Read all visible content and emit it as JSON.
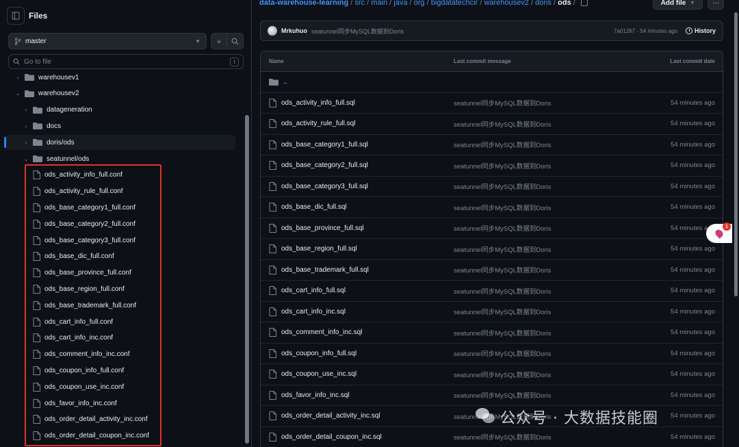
{
  "sidebar": {
    "title": "Files",
    "branch": "master",
    "search_placeholder": "Go to file",
    "search_shortcut": "t",
    "tree": [
      {
        "label": "warehousev1",
        "kind": "folder",
        "depth": 0,
        "expanded": false
      },
      {
        "label": "warehousev2",
        "kind": "folder",
        "depth": 0,
        "expanded": true
      },
      {
        "label": "datageneration",
        "kind": "folder",
        "depth": 1,
        "expanded": false
      },
      {
        "label": "docs",
        "kind": "folder",
        "depth": 1,
        "expanded": false
      },
      {
        "label": "doris/ods",
        "kind": "folder",
        "depth": 1,
        "expanded": false,
        "active": true
      },
      {
        "label": "seatunnel/ods",
        "kind": "folder",
        "depth": 1,
        "expanded": true
      },
      {
        "label": "ods_activity_info_full.conf",
        "kind": "file",
        "depth": 2
      },
      {
        "label": "ods_activity_rule_full.conf",
        "kind": "file",
        "depth": 2
      },
      {
        "label": "ods_base_category1_full.conf",
        "kind": "file",
        "depth": 2
      },
      {
        "label": "ods_base_category2_full.conf",
        "kind": "file",
        "depth": 2
      },
      {
        "label": "ods_base_category3_full.conf",
        "kind": "file",
        "depth": 2
      },
      {
        "label": "ods_base_dic_full.conf",
        "kind": "file",
        "depth": 2
      },
      {
        "label": "ods_base_province_full.conf",
        "kind": "file",
        "depth": 2
      },
      {
        "label": "ods_base_region_full.conf",
        "kind": "file",
        "depth": 2
      },
      {
        "label": "ods_base_trademark_full.conf",
        "kind": "file",
        "depth": 2
      },
      {
        "label": "ods_cart_info_full.conf",
        "kind": "file",
        "depth": 2
      },
      {
        "label": "ods_cart_info_inc.conf",
        "kind": "file",
        "depth": 2
      },
      {
        "label": "ods_comment_info_inc.conf",
        "kind": "file",
        "depth": 2
      },
      {
        "label": "ods_coupon_info_full.conf",
        "kind": "file",
        "depth": 2
      },
      {
        "label": "ods_coupon_use_inc.conf",
        "kind": "file",
        "depth": 2
      },
      {
        "label": "ods_favor_info_inc.conf",
        "kind": "file",
        "depth": 2
      },
      {
        "label": "ods_order_detail_activity_inc.conf",
        "kind": "file",
        "depth": 2
      },
      {
        "label": "ods_order_detail_coupon_inc.conf",
        "kind": "file",
        "depth": 2
      }
    ]
  },
  "breadcrumb": {
    "repo": "data-warehouse-learning",
    "parts": [
      "src",
      "main",
      "java",
      "org",
      "bigdatatechcir",
      "warehousev2",
      "doris"
    ],
    "current": "ods",
    "sep": "/"
  },
  "toolbar": {
    "add_file": "Add file",
    "more": "···"
  },
  "commit": {
    "author": "Mrkuhuo",
    "message": "seatunnel同步MySQL数据到Doris",
    "hash_time": "7a01267 · 54 minutes ago",
    "history": "History"
  },
  "table": {
    "headers": {
      "name": "Name",
      "message": "Last commit message",
      "date": "Last commit date"
    },
    "parent": "..",
    "rows": [
      {
        "name": "ods_activity_info_full.sql",
        "message": "seatunnel同步MySQL数据到Doris",
        "date": "54 minutes ago"
      },
      {
        "name": "ods_activity_rule_full.sql",
        "message": "seatunnel同步MySQL数据到Doris",
        "date": "54 minutes ago"
      },
      {
        "name": "ods_base_category1_full.sql",
        "message": "seatunnel同步MySQL数据到Doris",
        "date": "54 minutes ago"
      },
      {
        "name": "ods_base_category2_full.sql",
        "message": "seatunnel同步MySQL数据到Doris",
        "date": "54 minutes ago"
      },
      {
        "name": "ods_base_category3_full.sql",
        "message": "seatunnel同步MySQL数据到Doris",
        "date": "54 minutes ago"
      },
      {
        "name": "ods_base_dic_full.sql",
        "message": "seatunnel同步MySQL数据到Doris",
        "date": "54 minutes ago"
      },
      {
        "name": "ods_base_province_full.sql",
        "message": "seatunnel同步MySQL数据到Doris",
        "date": "54 minutes ago"
      },
      {
        "name": "ods_base_region_full.sql",
        "message": "seatunnel同步MySQL数据到Doris",
        "date": "54 minutes ago"
      },
      {
        "name": "ods_base_trademark_full.sql",
        "message": "seatunnel同步MySQL数据到Doris",
        "date": "54 minutes ago"
      },
      {
        "name": "ods_cart_info_full.sql",
        "message": "seatunnel同步MySQL数据到Doris",
        "date": "54 minutes ago"
      },
      {
        "name": "ods_cart_info_inc.sql",
        "message": "seatunnel同步MySQL数据到Doris",
        "date": "54 minutes ago"
      },
      {
        "name": "ods_comment_info_inc.sql",
        "message": "seatunnel同步MySQL数据到Doris",
        "date": "54 minutes ago"
      },
      {
        "name": "ods_coupon_info_full.sql",
        "message": "seatunnel同步MySQL数据到Doris",
        "date": "54 minutes ago"
      },
      {
        "name": "ods_coupon_use_inc.sql",
        "message": "seatunnel同步MySQL数据到Doris",
        "date": "54 minutes ago"
      },
      {
        "name": "ods_favor_info_inc.sql",
        "message": "seatunnel同步MySQL数据到Doris",
        "date": "54 minutes ago"
      },
      {
        "name": "ods_order_detail_activity_inc.sql",
        "message": "seatunnel同步MySQL数据到Doris",
        "date": "54 minutes ago"
      },
      {
        "name": "ods_order_detail_coupon_inc.sql",
        "message": "seatunnel同步MySQL数据到Doris",
        "date": "54 minutes ago"
      }
    ]
  },
  "widget": {
    "badge": "1"
  },
  "watermark": {
    "text": "公众号 · 大数据技能圈"
  },
  "colors": {
    "accent": "#4493f8",
    "highlight": "#e5322d",
    "bg": "#0d1117"
  }
}
